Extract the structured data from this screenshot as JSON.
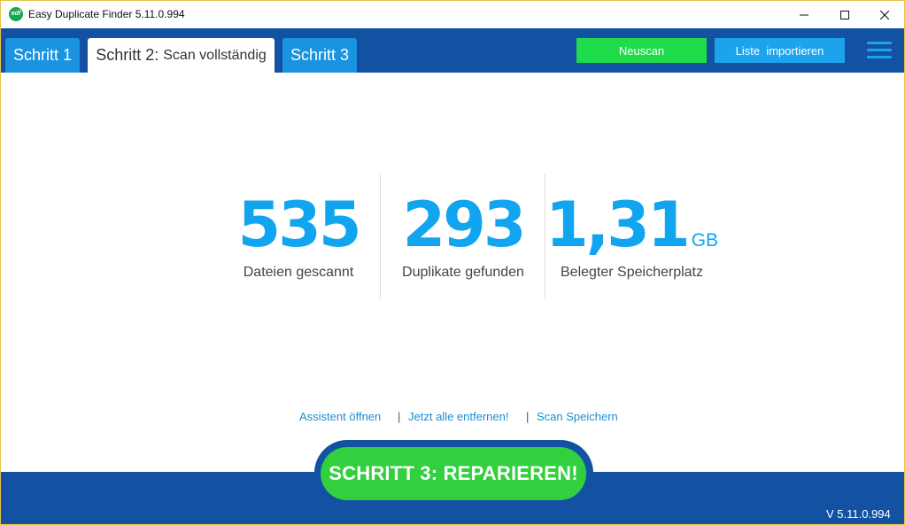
{
  "window": {
    "title": "Easy Duplicate Finder 5.11.0.994",
    "icon_text": "edf",
    "controls": [
      "minimize-icon",
      "maximize-icon",
      "close-icon"
    ]
  },
  "tabs": {
    "tab1": "Schritt 1",
    "tab2_main": "Schritt 2:",
    "tab2_sub": "Scan vollständig",
    "tab3": "Schritt 3"
  },
  "header_buttons": {
    "rescan": "Neuscan",
    "import": "Liste  importieren",
    "menu_icon": "hamburger-menu-icon"
  },
  "stats": {
    "files_scanned": {
      "value": "535",
      "label": "Dateien gescannt"
    },
    "duplicates_found": {
      "value": "293",
      "label": "Duplikate gefunden"
    },
    "space_used": {
      "value": "1,31",
      "unit": "GB",
      "label": "Belegter Speicherplatz"
    }
  },
  "links": {
    "assistant": "Assistent öffnen",
    "separator": "|",
    "remove_all": "Jetzt alle entfernen!",
    "save_scan": "Scan Speichern"
  },
  "footer": {
    "repair_button": "SCHRITT 3: REPARIEREN!",
    "version": "V 5.11.0.994"
  },
  "colors": {
    "header_blue": "#1352a3",
    "accent_blue": "#12a5ef",
    "green": "#32cf3e",
    "rescan_green": "#1fdd4a"
  }
}
